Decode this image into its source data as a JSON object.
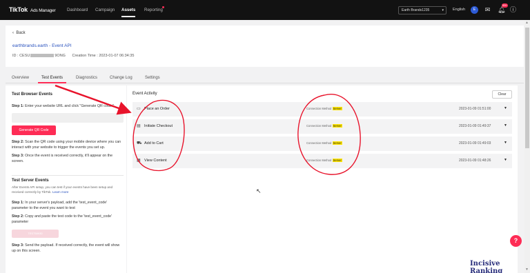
{
  "topnav": {
    "logo": "TikTok",
    "logo_sub": "Ads Manager",
    "items": [
      "Dashboard",
      "Campaign",
      "Assets",
      "Reporting"
    ],
    "account": "Earth Brands1235",
    "language": "English",
    "avatar": "E",
    "notif_count": "99+"
  },
  "header": {
    "back": "Back",
    "title": "earthbrands.earth - Event API",
    "id_prefix": "ID : CESU",
    "id_suffix": "9ONG",
    "creation_time": "Creation Time : 2023-01-07 06:34:35"
  },
  "tabs": [
    "Overview",
    "Test Events",
    "Diagnostics",
    "Change Log",
    "Settings"
  ],
  "left": {
    "browser_title": "Test Browser Events",
    "step1_label": "Step 1:",
    "step1_text": " Enter your website URL and click \"Generate QR code.\"",
    "qr_button": "Generate QR Code",
    "step2_label": "Step 2:",
    "step2_text": " Scan the QR code using your mobile device where you can interact with your website to trigger the events you set up.",
    "step3_label": "Step 3:",
    "step3_text": " Once the event is received correctly, it'll appear on the screen.",
    "server_title": "Test Server Events",
    "server_desc": "After Events API setup, you can test if your events have been setup and received correctly by TikTok.",
    "learn_more": "Learn more",
    "s_step1_label": "Step 1:",
    "s_step1_text": " In your server's payload, add the 'test_event_code' parameter to the event you want to test",
    "s_step2_label": "Step 2:",
    "s_step2_text": " Copy and paste the test code to the 'test_event_code' parameter",
    "test_code": "TEST50930",
    "s_step3_label": "Step 3:",
    "s_step3_text": " Send the payload. If received correctly, the event will show up on this screen."
  },
  "activity": {
    "title": "Event Activity",
    "clear": "Clear",
    "method_label": "Connection Method",
    "events": [
      {
        "name": "Place an Order",
        "icon": "order-icon",
        "method": "Server",
        "time": "2023-01-09 01:51:00"
      },
      {
        "name": "Initiate Checkout",
        "icon": "checkout-icon",
        "method": "Server",
        "time": "2023-01-09 01:49:37"
      },
      {
        "name": "Add to Cart",
        "icon": "cart-icon",
        "method": "Server",
        "time": "2023-01-09 01:49:03"
      },
      {
        "name": "View Content",
        "icon": "content-icon",
        "method": "Server",
        "time": "2023-01-09 01:48:26"
      }
    ]
  },
  "watermark": "Incisive Ranking",
  "colors": {
    "accent": "#fe2c55",
    "nav_bg": "#121212",
    "link": "#2a52be",
    "highlight": "#ffe600",
    "annotation": "#e8132b"
  }
}
